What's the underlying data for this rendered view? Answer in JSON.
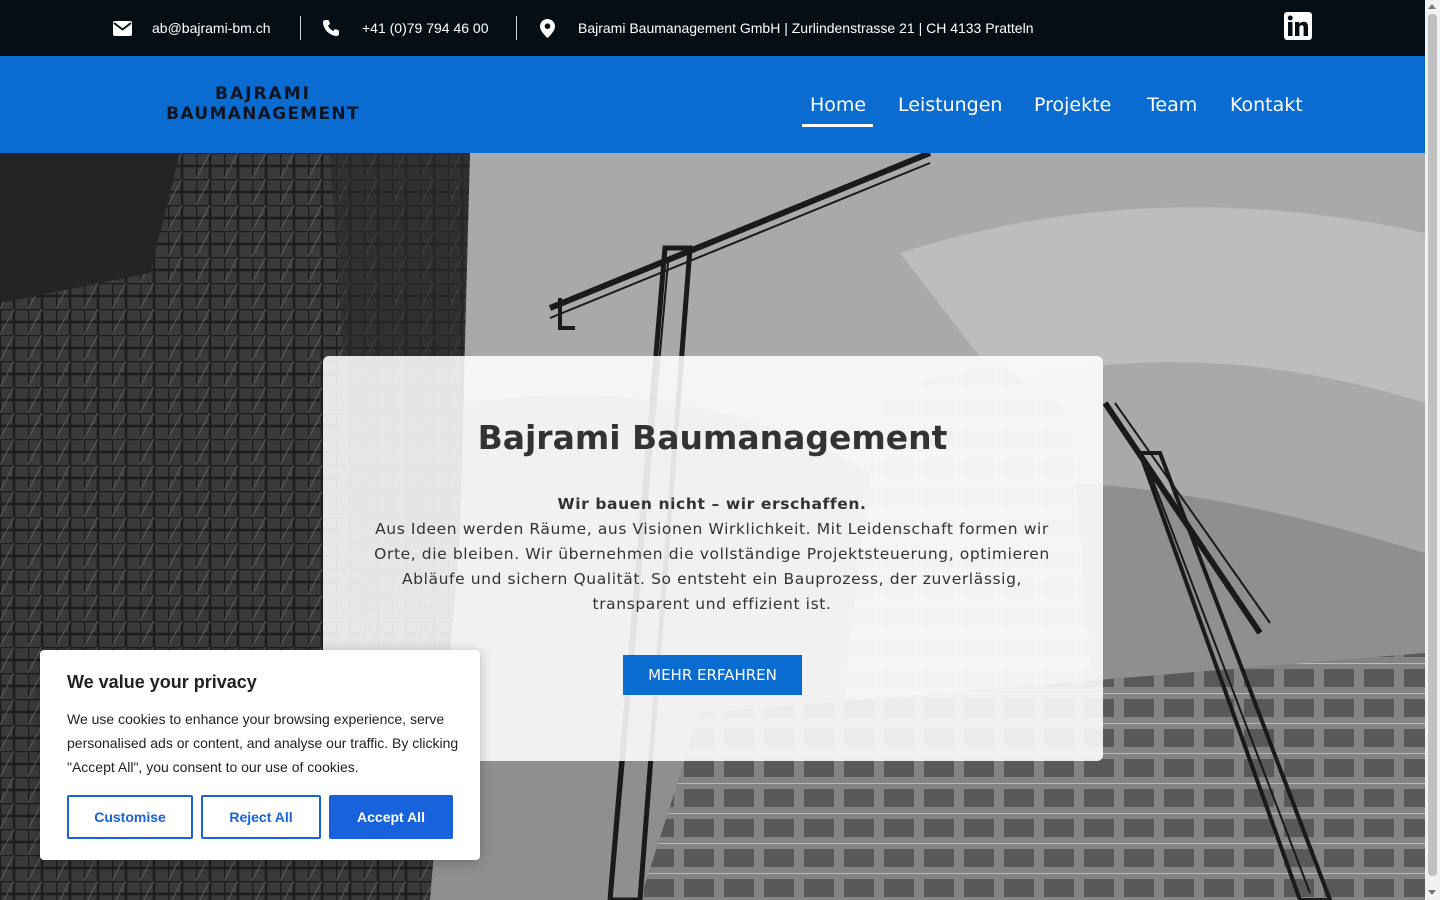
{
  "topbar": {
    "email": "ab@bajrami-bm.ch",
    "phone": "+41 (0)79 794 46 00",
    "address": "Bajrami Baumanagement GmbH | Zurlindenstrasse 21 | CH 4133 Pratteln",
    "icons": [
      "envelope-icon",
      "phone-icon",
      "map-pin-icon",
      "linkedin-icon"
    ]
  },
  "logo": {
    "line1": "BAJRAMI",
    "line2": "BAUMANAGEMENT"
  },
  "nav": {
    "items": [
      {
        "label": "Home",
        "active": true
      },
      {
        "label": "Leistungen",
        "active": false
      },
      {
        "label": "Projekte",
        "active": false
      },
      {
        "label": "Team",
        "active": false
      },
      {
        "label": "Kontakt",
        "active": false
      }
    ]
  },
  "hero": {
    "title": "Bajrami Baumanagement",
    "tagline": "Wir bauen nicht – wir erschaffen.",
    "body": "Aus Ideen werden Räume, aus Visionen Wirklichkeit. Mit Leidenschaft formen wir Orte, die bleiben. Wir übernehmen die vollständige Projektsteuerung, optimieren Abläufe und sichern Qualität. So entsteht ein Bauprozess, der zuverlässig, transparent und effizient ist.",
    "cta_label": "MEHR ERFAHREN"
  },
  "cookie": {
    "title": "We value your privacy",
    "text": "We use cookies to enhance your browsing experience, serve personalised ads or content, and analyse our traffic. By clicking \"Accept All\", you consent to our use of cookies.",
    "customise_label": "Customise",
    "reject_label": "Reject All",
    "accept_label": "Accept All"
  },
  "colors": {
    "topbar_bg": "#050e14",
    "nav_bg": "#0a6bd0",
    "cta_bg": "#0a6bd0",
    "cookie_accent": "#1863dc"
  }
}
